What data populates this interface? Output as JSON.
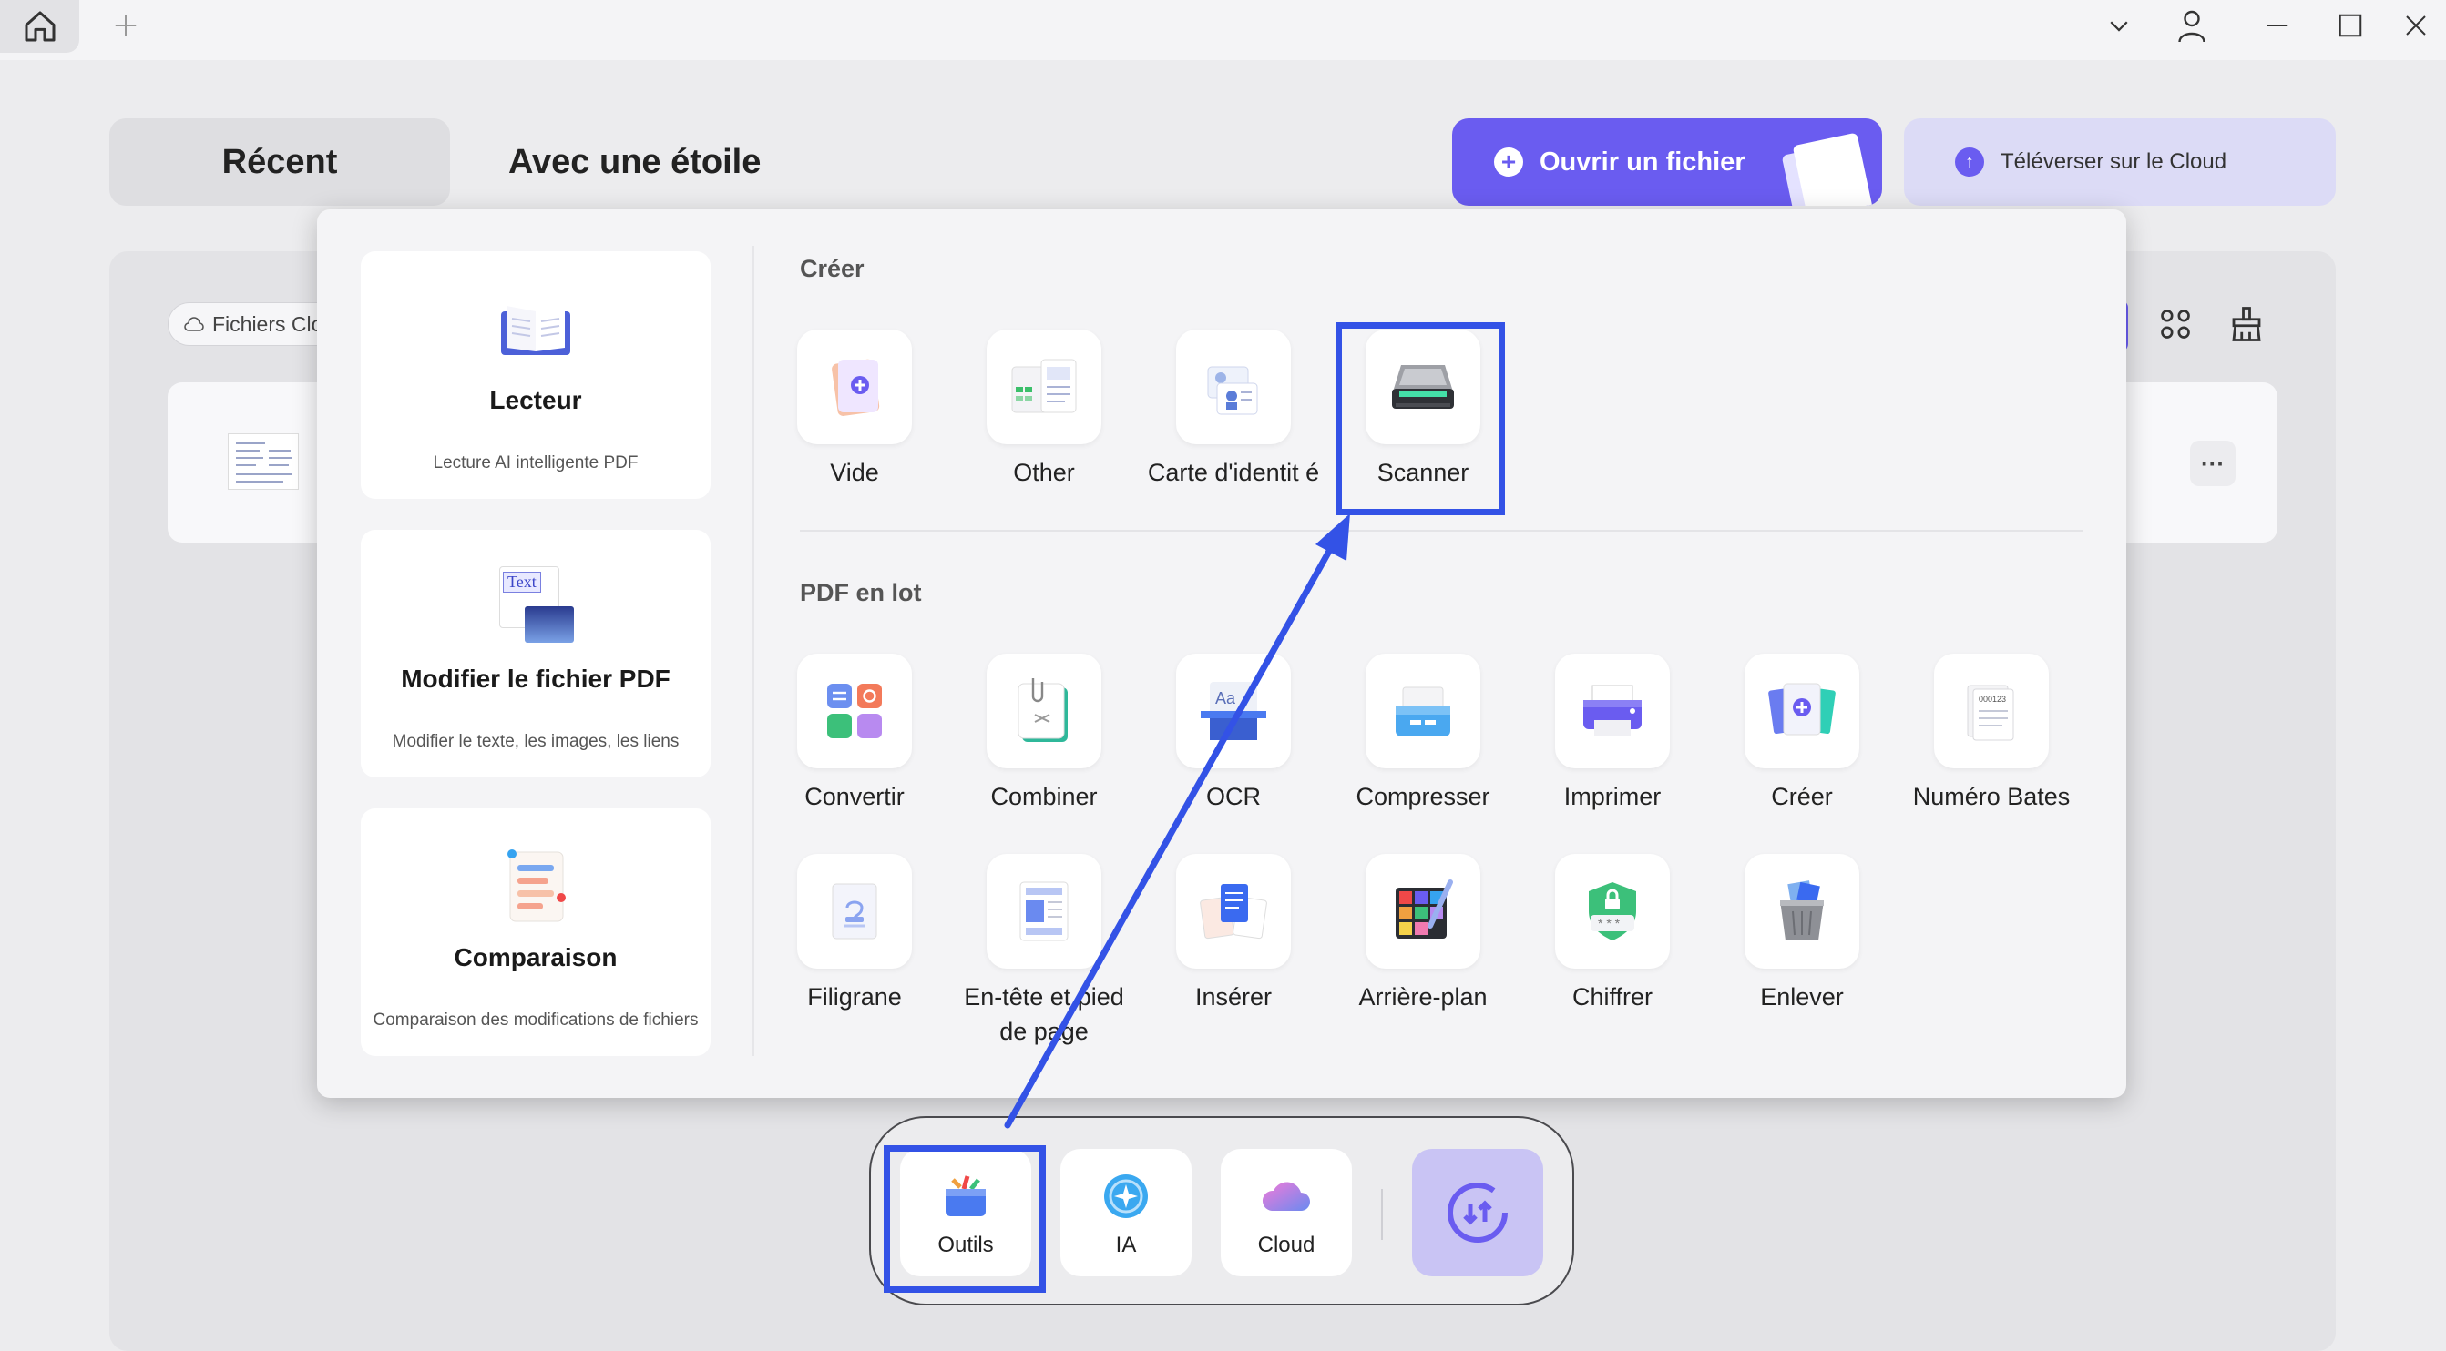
{
  "titlebar": {
    "home_icon": "home-icon",
    "new_tab_icon": "plus-icon",
    "controls": [
      "chevron-down-icon",
      "user-icon",
      "minimize-icon",
      "maximize-icon",
      "close-icon"
    ]
  },
  "tabs": {
    "recent": "Récent",
    "starred": "Avec une étoile"
  },
  "actions": {
    "open_file": "Ouvrir un fichier",
    "upload_cloud": "Téléverser sur le Cloud"
  },
  "filter": {
    "cloud_files": "Fichiers Clo"
  },
  "file_row": {
    "more": "···"
  },
  "features": [
    {
      "title": "Lecteur",
      "subtitle": "Lecture AI intelligente PDF"
    },
    {
      "title": "Modifier le fichier PDF",
      "subtitle": "Modifier le texte, les images, les liens",
      "badge": "Text"
    },
    {
      "title": "Comparaison",
      "subtitle": "Comparaison des modifications de fichiers"
    }
  ],
  "create_section": {
    "title": "Créer",
    "tools": [
      {
        "label": "Vide"
      },
      {
        "label": "Other"
      },
      {
        "label": "Carte d'identit é"
      },
      {
        "label": "Scanner"
      }
    ]
  },
  "batch_section": {
    "title": "PDF en lot",
    "tools": [
      {
        "label": "Convertir"
      },
      {
        "label": "Combiner"
      },
      {
        "label": "OCR"
      },
      {
        "label": "Compresser"
      },
      {
        "label": "Imprimer"
      },
      {
        "label": "Créer"
      },
      {
        "label": "Numéro Bates"
      },
      {
        "label": "Filigrane"
      },
      {
        "label": "En-tête et pied de page"
      },
      {
        "label": "Insérer"
      },
      {
        "label": "Arrière-plan"
      },
      {
        "label": "Chiffrer"
      },
      {
        "label": "Enlever"
      }
    ]
  },
  "dock": {
    "tools": "Outils",
    "ai": "IA",
    "cloud": "Cloud"
  },
  "colors": {
    "accent": "#6a5cf0",
    "highlight": "#3352e6"
  }
}
